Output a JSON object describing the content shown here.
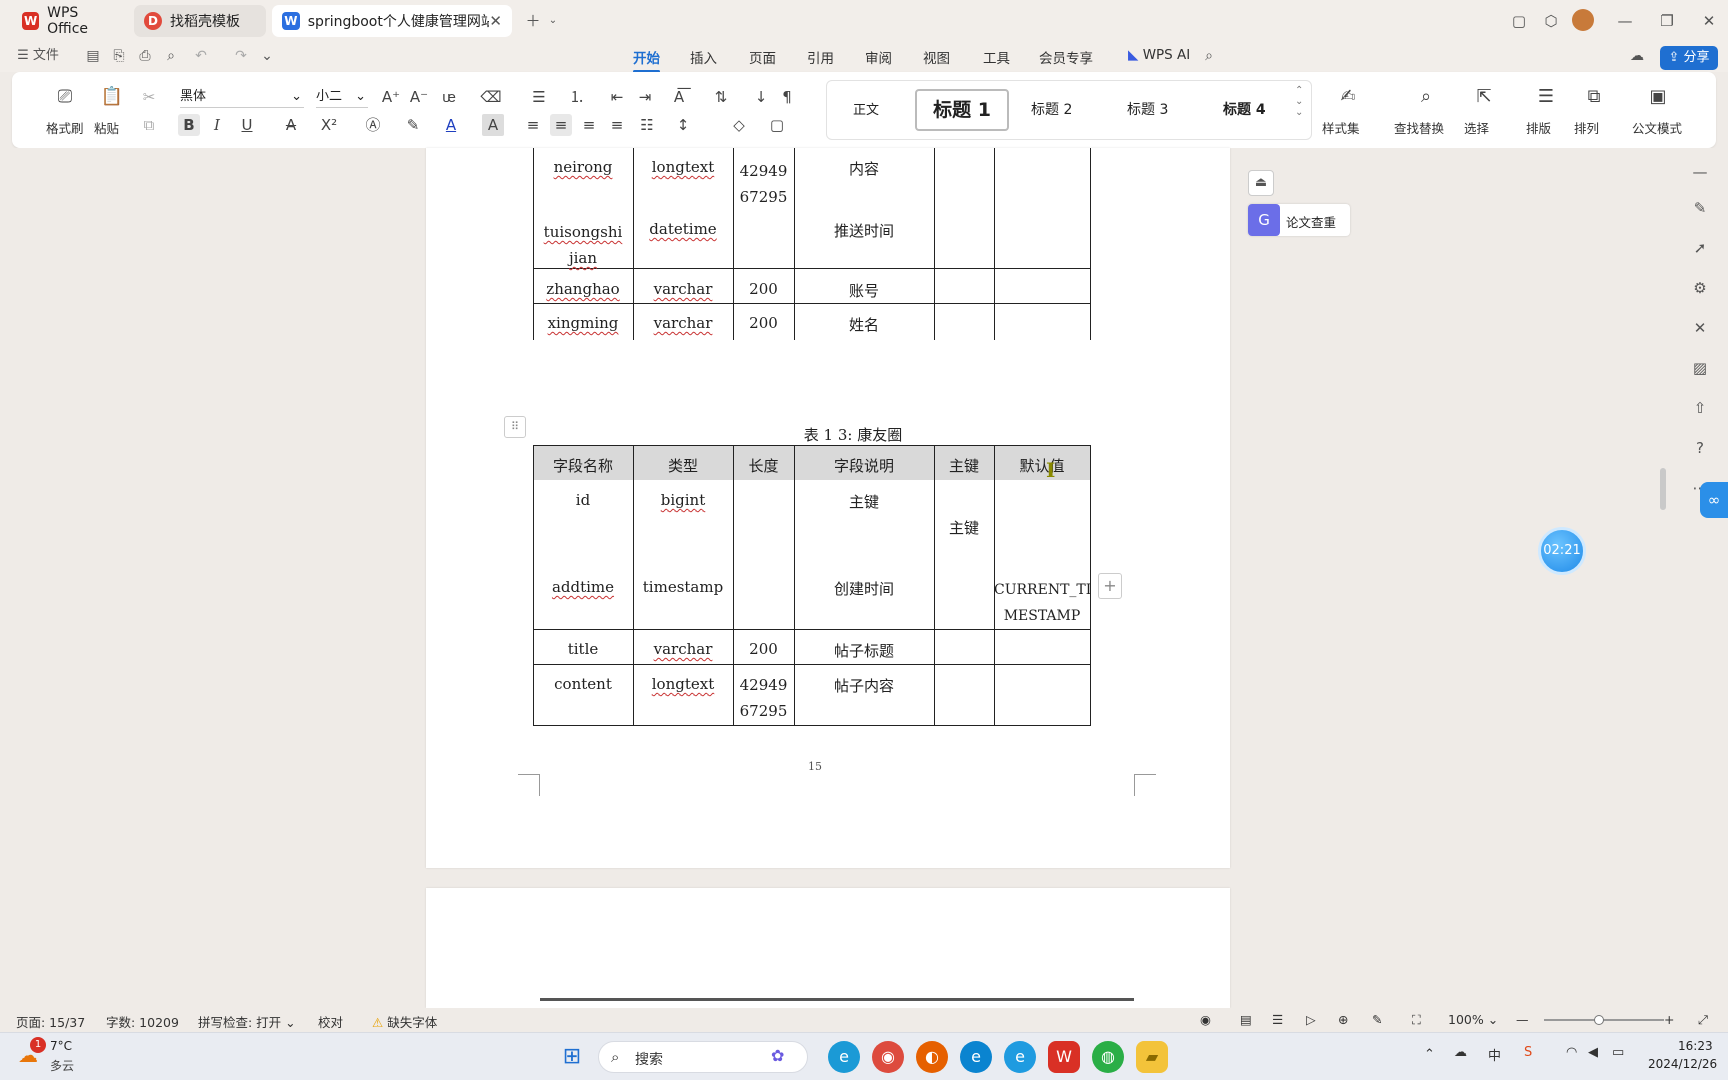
{
  "tabs": [
    {
      "label": "WPS Office",
      "icon": "wps-logo-icon"
    },
    {
      "label": "找稻壳模板",
      "icon": "docer-icon"
    },
    {
      "label": "springboot个人健康管理网站的设",
      "icon": "word-doc-icon"
    }
  ],
  "menu": {
    "file": "文件",
    "tabs": [
      "开始",
      "插入",
      "页面",
      "引用",
      "审阅",
      "视图",
      "工具",
      "会员专享"
    ],
    "wps_ai": "WPS AI",
    "share": "分享"
  },
  "ribbon": {
    "format_painter": "格式刷",
    "paste": "粘贴",
    "font_name": "黑体",
    "font_size": "小二",
    "styles": [
      "正文",
      "标题 1",
      "标题 2",
      "标题 3",
      "标题 4"
    ],
    "style_set": "样式集",
    "find_replace": "查找替换",
    "select": "选择",
    "layout": "排版",
    "arrange": "排列",
    "official_mode": "公文模式"
  },
  "side_panel": {
    "paper_check": "论文查重",
    "timer": "02:21"
  },
  "table_top": {
    "rows": [
      {
        "name": "neirong",
        "type": "longtext",
        "length": "42949\n67295",
        "desc": "内容",
        "pk": "",
        "default": ""
      },
      {
        "name": "tuisongshi\njian",
        "type": "datetime",
        "length": "",
        "desc": "推送时间",
        "pk": "",
        "default": ""
      },
      {
        "name": "zhanghao",
        "type": "varchar",
        "length": "200",
        "desc": "账号",
        "pk": "",
        "default": ""
      },
      {
        "name": "xingming",
        "type": "varchar",
        "length": "200",
        "desc": "姓名",
        "pk": "",
        "default": ""
      }
    ]
  },
  "table_main": {
    "caption": "表 1 3: 康友圈",
    "headers": [
      "字段名称",
      "类型",
      "长度",
      "字段说明",
      "主键",
      "默认值"
    ],
    "rows": [
      {
        "name": "id",
        "type": "bigint",
        "length": "",
        "desc": "主键",
        "pk": "主键",
        "default": ""
      },
      {
        "name": "addtime",
        "type": "timestamp",
        "length": "",
        "desc": "创建时间",
        "pk": "",
        "default": "CURRENT_TI\nMESTAMP"
      },
      {
        "name": "title",
        "type": "varchar",
        "length": "200",
        "desc": "帖子标题",
        "pk": "",
        "default": ""
      },
      {
        "name": "content",
        "type": "longtext",
        "length": "42949\n67295",
        "desc": "帖子内容",
        "pk": "",
        "default": ""
      }
    ]
  },
  "page_number": "15",
  "status": {
    "page": "页面: 15/37",
    "words": "字数: 10209",
    "spell": "拼写检查: 打开",
    "proof": "校对",
    "missing_font": "缺失字体",
    "zoom": "100%"
  },
  "taskbar": {
    "weather_temp": "7°C",
    "weather_desc": "多云",
    "weather_badge": "1",
    "search": "搜索",
    "time": "16:23",
    "date": "2024/12/26"
  },
  "colors": {
    "accent": "#1f6fd1",
    "wps_red": "#d93025",
    "table_header_bg": "#d9d9d9"
  }
}
